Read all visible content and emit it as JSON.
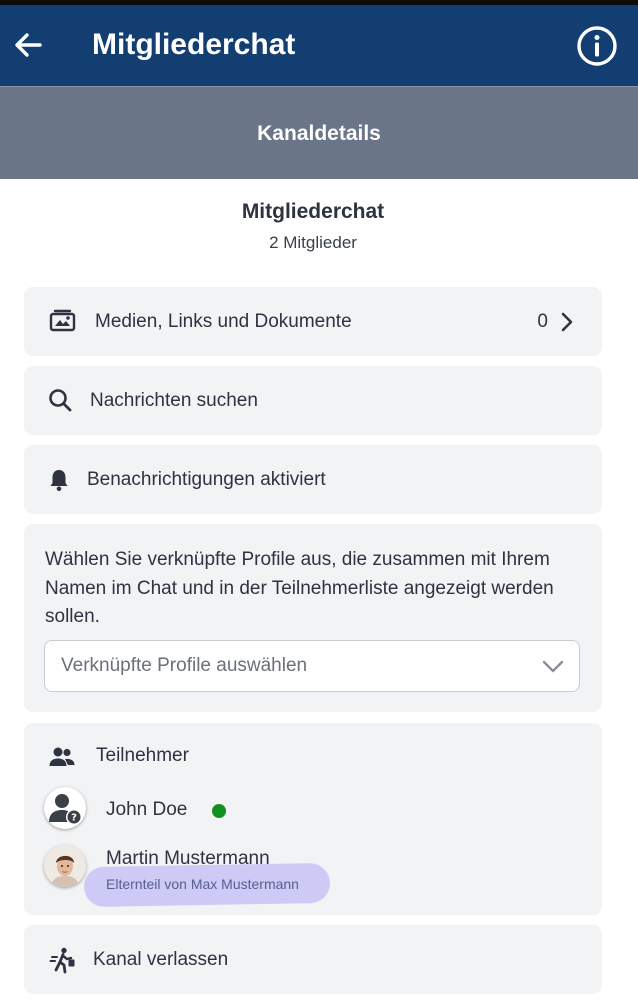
{
  "app_bar": {
    "title": "Mitgliederchat",
    "back_icon": "arrow-left-icon",
    "info_icon": "info-circle-icon"
  },
  "subheader": {
    "title": "Kanaldetails"
  },
  "channel": {
    "name": "Mitgliederchat",
    "members": "2 Mitglieder"
  },
  "actions": {
    "media": {
      "icon": "media-documents-icon",
      "label": "Medien, Links und Dokumente",
      "count": "0",
      "chevron": "chevron-right-icon"
    },
    "search": {
      "icon": "search-icon",
      "label": "Nachrichten suchen"
    },
    "notifications": {
      "icon": "bell-icon",
      "label": "Benachrichtigungen aktiviert"
    }
  },
  "linked_profiles": {
    "description": "Wählen Sie verknüpfte Profile aus, die zusammen mit Ihrem Namen im Chat und in der Teilnehmerliste angezeigt werden sollen.",
    "placeholder": "Verknüpfte Profile auswählen",
    "dropdown_icon": "chevron-down-icon"
  },
  "participants": {
    "heading": "Teilnehmer",
    "icon": "people-icon",
    "list": [
      {
        "name": "John Doe",
        "online": true,
        "avatar": "unknown-user-avatar"
      },
      {
        "name": "Martin Mustermann",
        "role": "Elternteil von Max Mustermann",
        "avatar": "photo-avatar"
      }
    ]
  },
  "leave": {
    "icon": "leave-walking-icon",
    "label": "Kanal verlassen"
  },
  "colors": {
    "app_bar": "#123e71",
    "subheader": "#6b7588",
    "card": "#f2f3f5",
    "online": "#12901f",
    "highlight": "#c9c7f5"
  }
}
